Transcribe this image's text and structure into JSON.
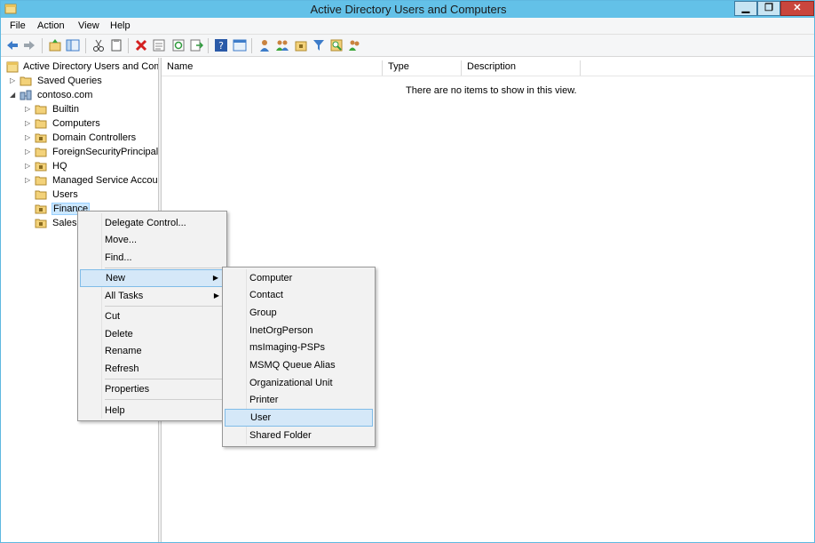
{
  "window": {
    "title": "Active Directory Users and Computers",
    "controls": {
      "minimize": "▁",
      "maximize": "❐",
      "close": "✕"
    }
  },
  "menubar": [
    "File",
    "Action",
    "View",
    "Help"
  ],
  "toolbar": {
    "icons": [
      "back-icon",
      "forward-icon",
      "up-folder-icon",
      "show-hide-tree-icon",
      "cut-icon",
      "copy-icon",
      "delete-icon",
      "properties-icon",
      "refresh-icon",
      "export-list-icon",
      "help-icon",
      "console-icon",
      "new-user-icon",
      "new-group-icon",
      "new-ou-icon",
      "filter-icon",
      "find-icon",
      "add-to-group-icon"
    ]
  },
  "tree": {
    "root": "Active Directory Users and Com",
    "saved_queries": "Saved Queries",
    "domain": "contoso.com",
    "children": [
      "Builtin",
      "Computers",
      "Domain Controllers",
      "ForeignSecurityPrincipals",
      "HQ",
      "Managed Service Accour",
      "Users",
      "Finance",
      "Sales"
    ]
  },
  "list": {
    "columns": [
      "Name",
      "Type",
      "Description"
    ],
    "empty_message": "There are no items to show in this view."
  },
  "context_menu": {
    "items": [
      "Delegate Control...",
      "Move...",
      "Find...",
      "New",
      "All Tasks",
      "Cut",
      "Delete",
      "Rename",
      "Refresh",
      "Properties",
      "Help"
    ],
    "submenu_arrow": "▶"
  },
  "new_submenu": {
    "items": [
      "Computer",
      "Contact",
      "Group",
      "InetOrgPerson",
      "msImaging-PSPs",
      "MSMQ Queue Alias",
      "Organizational Unit",
      "Printer",
      "User",
      "Shared Folder"
    ]
  },
  "colors": {
    "titlebar": "#63c1e8",
    "highlight": "#d5e8f8",
    "folder": "#f3d27a"
  }
}
